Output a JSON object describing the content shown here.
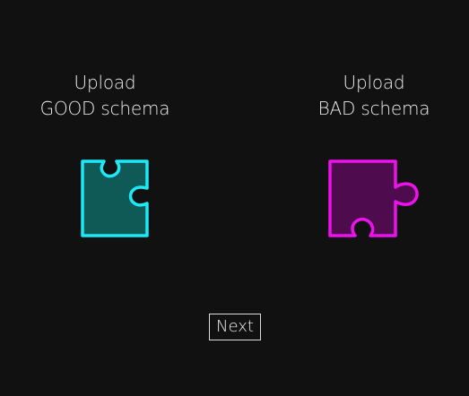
{
  "good_upload": {
    "line1": "Upload",
    "line2": "GOOD schema",
    "icon": "puzzle-piece-icon",
    "stroke_color": "#1de9f6",
    "fill_color": "#0f5a57"
  },
  "bad_upload": {
    "line1": "Upload",
    "line2": "BAD schema",
    "icon": "puzzle-piece-icon",
    "stroke_color": "#ec12ec",
    "fill_color": "#4e0b4e"
  },
  "next_button": {
    "label": "Next"
  }
}
